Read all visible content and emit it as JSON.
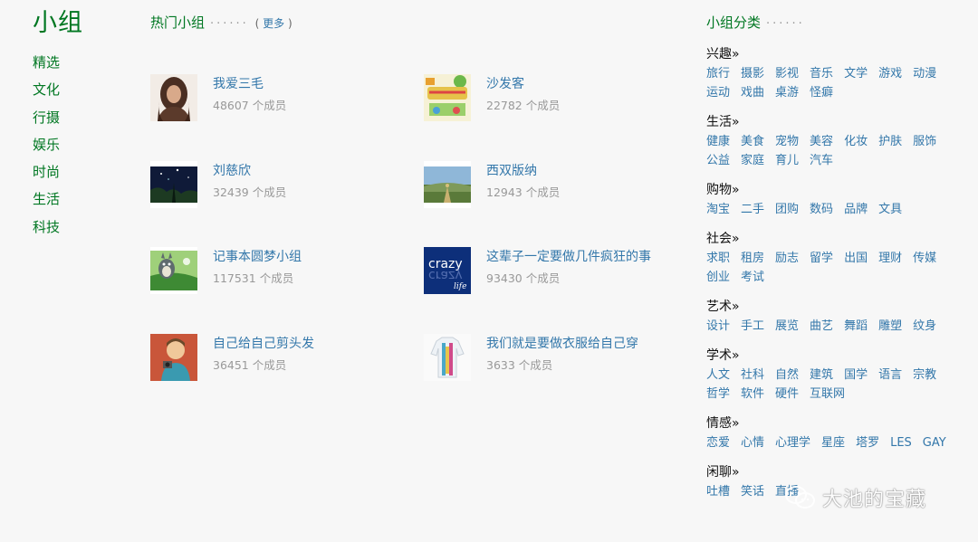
{
  "leftnav": {
    "logo": "小组",
    "items": [
      "精选",
      "文化",
      "行摄",
      "娱乐",
      "时尚",
      "生活",
      "科技"
    ]
  },
  "hot": {
    "title": "热门小组",
    "dots": "······",
    "more_open": "(",
    "more_label": "更多",
    "more_close": ")",
    "groups": [
      {
        "name": "我爱三毛",
        "members": "48607 个成员",
        "thumb": "portrait-woman"
      },
      {
        "name": "沙发客",
        "members": "22782 个成员",
        "thumb": "sofa-poster"
      },
      {
        "name": "刘慈欣",
        "members": "32439 个成员",
        "thumb": "night-sky"
      },
      {
        "name": "西双版纳",
        "members": "12943 个成员",
        "thumb": "landscape"
      },
      {
        "name": "记事本圆梦小组",
        "members": "117531 个成员",
        "thumb": "totoro"
      },
      {
        "name": "这辈子一定要做几件疯狂的事",
        "members": "93430 个成员",
        "thumb": "crazy-logo"
      },
      {
        "name": "自己给自己剪头发",
        "members": "36451 个成员",
        "thumb": "cartoon-person"
      },
      {
        "name": "我们就是要做衣服给自己穿",
        "members": "3633 个成员",
        "thumb": "clothes"
      }
    ],
    "crazy_text": "crazy",
    "crazy_sub": "life"
  },
  "cats": {
    "title": "小组分类",
    "dots": "······",
    "blocks": [
      {
        "title": "兴趣»",
        "tags": [
          "旅行",
          "摄影",
          "影视",
          "音乐",
          "文学",
          "游戏",
          "动漫",
          "运动",
          "戏曲",
          "桌游",
          "怪癖"
        ]
      },
      {
        "title": "生活»",
        "tags": [
          "健康",
          "美食",
          "宠物",
          "美容",
          "化妆",
          "护肤",
          "服饰",
          "公益",
          "家庭",
          "育儿",
          "汽车"
        ]
      },
      {
        "title": "购物»",
        "tags": [
          "淘宝",
          "二手",
          "团购",
          "数码",
          "品牌",
          "文具"
        ]
      },
      {
        "title": "社会»",
        "tags": [
          "求职",
          "租房",
          "励志",
          "留学",
          "出国",
          "理财",
          "传媒",
          "创业",
          "考试"
        ]
      },
      {
        "title": "艺术»",
        "tags": [
          "设计",
          "手工",
          "展览",
          "曲艺",
          "舞蹈",
          "雕塑",
          "纹身"
        ]
      },
      {
        "title": "学术»",
        "tags": [
          "人文",
          "社科",
          "自然",
          "建筑",
          "国学",
          "语言",
          "宗教",
          "哲学",
          "软件",
          "硬件",
          "互联网"
        ]
      },
      {
        "title": "情感»",
        "tags": [
          "恋爱",
          "心情",
          "心理学",
          "星座",
          "塔罗",
          "LES",
          "GAY"
        ]
      },
      {
        "title": "闲聊»",
        "tags": [
          "吐槽",
          "笑话",
          "直播"
        ]
      }
    ]
  },
  "watermark": {
    "text": "大池的宝藏",
    "icon": "wechat-icon"
  }
}
